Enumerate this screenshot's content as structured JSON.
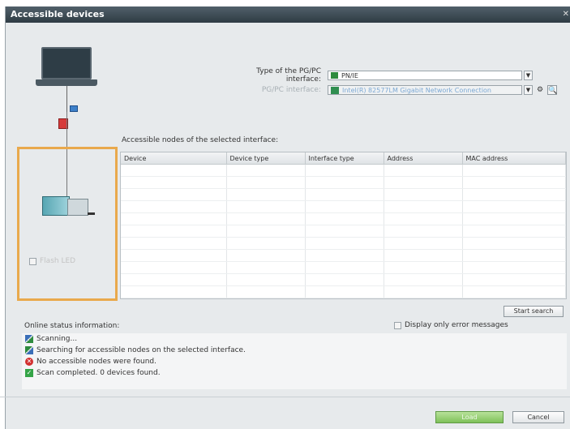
{
  "window": {
    "title": "Accessible devices"
  },
  "interface": {
    "type_label": "Type of the PG/PC interface:",
    "type_value": "PN/IE",
    "pgpc_label": "PG/PC interface:",
    "pgpc_value": "Intel(R) 82577LM Gigabit Network Connection"
  },
  "illustration": {
    "flash_led_label": "Flash LED"
  },
  "nodes": {
    "caption": "Accessible nodes of the selected interface:",
    "columns": [
      "Device",
      "Device type",
      "Interface type",
      "Address",
      "MAC address"
    ],
    "rows": []
  },
  "actions": {
    "start_search": "Start search"
  },
  "status": {
    "title": "Online status information:",
    "errors_only_label": "Display only error messages",
    "messages": [
      {
        "icon": "scan-icon",
        "text": "Scanning..."
      },
      {
        "icon": "search-network-icon",
        "text": "Searching for accessible nodes on the selected interface."
      },
      {
        "icon": "error-icon",
        "text": "No accessible nodes were found."
      },
      {
        "icon": "success-icon",
        "text": "Scan completed. 0 devices found."
      }
    ]
  },
  "footer": {
    "load_label": "Load",
    "cancel_label": "Cancel"
  },
  "colors": {
    "accent_orange": "#e9a94c",
    "title_bar": "#3a4852",
    "load_green": "#7fc15a"
  }
}
